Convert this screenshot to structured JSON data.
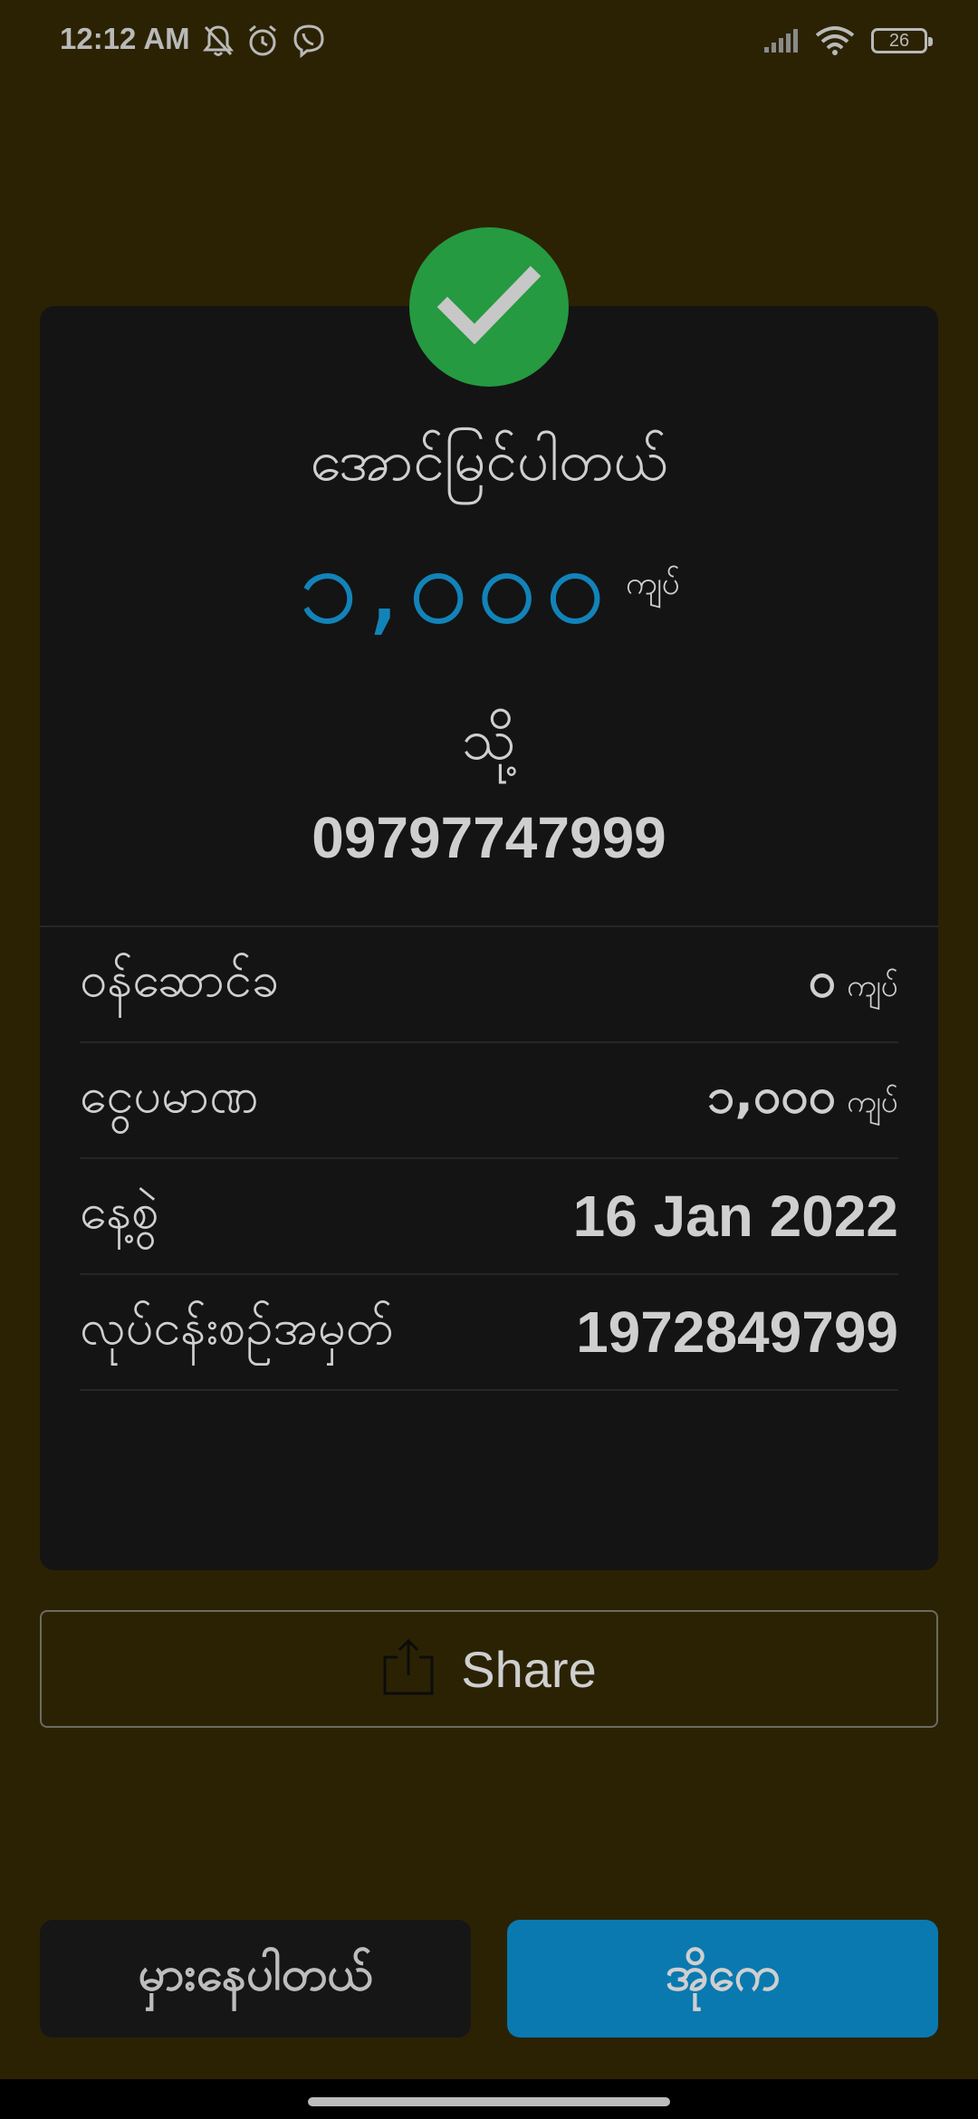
{
  "status_bar": {
    "time": "12:12 AM",
    "battery": "26"
  },
  "receipt": {
    "title": "အောင်မြင်ပါတယ်",
    "amount": "၁,၀၀၀",
    "amount_unit": "ကျပ်",
    "to_label": "သို့",
    "recipient": "09797747999",
    "details": [
      {
        "label": "ဝန်ဆောင်ခ",
        "value": "၀",
        "unit": "ကျပ်"
      },
      {
        "label": "ငွေပမာဏ",
        "value": "၁,၀၀၀",
        "unit": "ကျပ်"
      },
      {
        "label": "နေ့စွဲ",
        "value": "16 Jan 2022"
      },
      {
        "label": "လုပ်ငန်းစဉ်အမှတ်",
        "value": "1972849799"
      }
    ]
  },
  "share": {
    "label": "Share"
  },
  "actions": {
    "error_label": "မှားနေပါတယ်",
    "ok_label": "အိုကေ"
  },
  "colors": {
    "background": "#2b2203",
    "card": "#141414",
    "success": "#259a41",
    "accent": "#0a79b0",
    "amount": "#1283b8"
  }
}
